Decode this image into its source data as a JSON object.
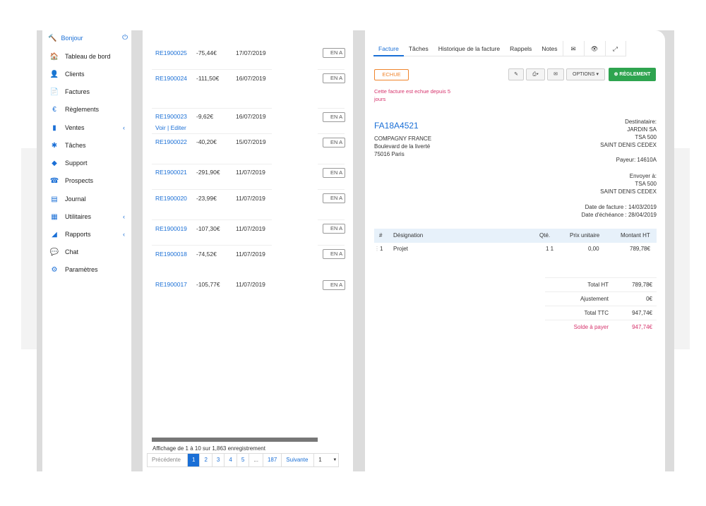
{
  "sidebar": {
    "greeting": "Bonjour",
    "items": [
      {
        "label": "Tableau de bord",
        "icon": "home-icon",
        "glyph": "🏠"
      },
      {
        "label": "Clients",
        "icon": "user-icon",
        "glyph": "👤"
      },
      {
        "label": "Factures",
        "icon": "document-icon",
        "glyph": "📄"
      },
      {
        "label": "Règlements",
        "icon": "euro-icon",
        "glyph": "€"
      },
      {
        "label": "Ventes",
        "icon": "bar-chart-icon",
        "glyph": "▮"
      },
      {
        "label": "Tâches",
        "icon": "puzzle-icon",
        "glyph": "✱"
      },
      {
        "label": "Support",
        "icon": "ticket-icon",
        "glyph": "◆"
      },
      {
        "label": "Prospects",
        "icon": "phone-icon",
        "glyph": "☎"
      },
      {
        "label": "Journal",
        "icon": "newspaper-icon",
        "glyph": "▤"
      },
      {
        "label": "Utilitaires",
        "icon": "grid-icon",
        "glyph": "▦"
      },
      {
        "label": "Rapports",
        "icon": "area-chart-icon",
        "glyph": "◢"
      },
      {
        "label": "Chat",
        "icon": "chat-icon",
        "glyph": "💬"
      },
      {
        "label": "Paramètres",
        "icon": "gear-icon",
        "glyph": "⚙"
      }
    ],
    "chevron": "‹"
  },
  "list": {
    "rows": [
      {
        "ref": "RE1900025",
        "amount": "-75,44€",
        "date": "17/07/2019",
        "status": "EN A"
      },
      {
        "ref": "RE1900024",
        "amount": "-111,50€",
        "date": "16/07/2019",
        "status": "EN A"
      },
      {
        "ref": "RE1900023",
        "amount": "-9,62€",
        "date": "16/07/2019",
        "status": "EN A",
        "links": "Voir | Editer"
      },
      {
        "ref": "RE1900022",
        "amount": "-40,20€",
        "date": "15/07/2019",
        "status": "EN A"
      },
      {
        "ref": "RE1900021",
        "amount": "-291,90€",
        "date": "11/07/2019",
        "status": "EN A"
      },
      {
        "ref": "RE1900020",
        "amount": "-23,99€",
        "date": "11/07/2019",
        "status": "EN A"
      },
      {
        "ref": "RE1900019",
        "amount": "-107,30€",
        "date": "11/07/2019",
        "status": "EN A"
      },
      {
        "ref": "RE1900018",
        "amount": "-74,52€",
        "date": "11/07/2019",
        "status": "EN A"
      },
      {
        "ref": "RE1900017",
        "amount": "-105,77€",
        "date": "11/07/2019",
        "status": "EN A"
      }
    ],
    "info": "Affichage de 1 à 10 sur 1,863 enregistrement",
    "pager": {
      "prev": "Précédente",
      "pages": [
        "1",
        "2",
        "3",
        "4",
        "5",
        "...",
        "187"
      ],
      "next": "Suivante",
      "select": "1",
      "caret": "▼"
    }
  },
  "detail": {
    "tabs": [
      "Facture",
      "Tâches",
      "Historique de la facture",
      "Rappels",
      "Notes"
    ],
    "tab_icons": {
      "mail": "✉",
      "eye": "👁",
      "expand": "⤢"
    },
    "status_badge": "ECHUE",
    "overdue_text": "Cette facture est echue depuis 5 jours",
    "toolbar": {
      "edit": "✎",
      "pdf": "⎙▾",
      "send": "✉",
      "options": "OPTIONS ▾",
      "payment": "⊕ RÈGLEMENT"
    },
    "invoice_number": "FA18A4521",
    "sender": [
      "COMPAGNY FRANCE",
      "Boulevard de la liverté",
      "75016 Paris"
    ],
    "recipient_label": "Destinataire:",
    "recipient": [
      "JARDIN SA",
      "TSA 500",
      "SAINT DENIS CEDEX"
    ],
    "payer": "Payeur: 14610A",
    "send_to_label": "Envoyer à:",
    "send_to": [
      "TSA 500",
      "SAINT DENIS CEDEX"
    ],
    "invoice_date": "Date de facture : 14/03/2019",
    "due_date": "Date d'échéance : 28/04/2019",
    "table": {
      "headers": [
        "#",
        "Désignation",
        "Qté.",
        "Prix unitaire",
        "Montant HT"
      ],
      "rows": [
        {
          "num": "1",
          "designation": "Projet",
          "qty": "1 1",
          "unit": "0,00",
          "amount": "789,78€"
        }
      ]
    },
    "totals": [
      {
        "label": "Total HT",
        "value": "789,78€"
      },
      {
        "label": "Ajustement",
        "value": "0€"
      },
      {
        "label": "Total TTC",
        "value": "947,74€"
      },
      {
        "label": "Solde à payer",
        "value": "947,74€"
      }
    ]
  }
}
